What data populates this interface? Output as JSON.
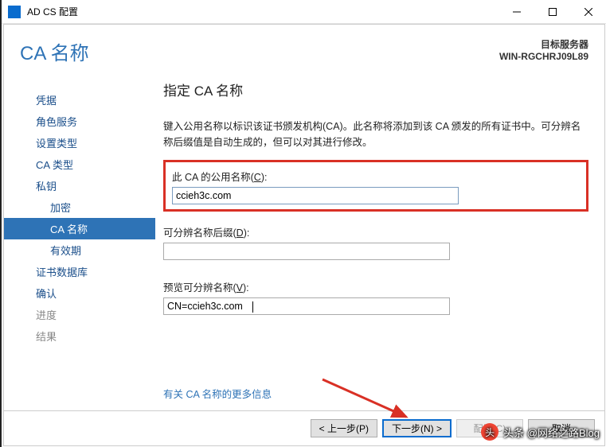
{
  "window": {
    "title": "AD CS 配置"
  },
  "header": {
    "page_title": "CA 名称",
    "server_label": "目标服务器",
    "server_name": "WIN-RGCHRJ09L89"
  },
  "nav": {
    "items": [
      {
        "label": "凭据",
        "key": "credentials"
      },
      {
        "label": "角色服务",
        "key": "role-services"
      },
      {
        "label": "设置类型",
        "key": "setup-type"
      },
      {
        "label": "CA 类型",
        "key": "ca-type"
      },
      {
        "label": "私钥",
        "key": "private-key"
      },
      {
        "label": "加密",
        "key": "crypto",
        "sub": true
      },
      {
        "label": "CA 名称",
        "key": "ca-name",
        "sub": true,
        "selected": true
      },
      {
        "label": "有效期",
        "key": "validity",
        "sub": true
      },
      {
        "label": "证书数据库",
        "key": "cert-db"
      },
      {
        "label": "确认",
        "key": "confirm"
      },
      {
        "label": "进度",
        "key": "progress",
        "disabled": true
      },
      {
        "label": "结果",
        "key": "results",
        "disabled": true
      }
    ]
  },
  "main": {
    "heading": "指定 CA 名称",
    "description": "键入公用名称以标识该证书颁发机构(CA)。此名称将添加到该 CA 颁发的所有证书中。可分辨名称后缀值是自动生成的，但可以对其进行修改。",
    "common_name": {
      "label_pre": "此 CA 的公用名称(",
      "accel": "C",
      "label_post": "):",
      "value": "ccieh3c.com"
    },
    "dn_suffix": {
      "label_pre": "可分辨名称后缀(",
      "accel": "D",
      "label_post": "):",
      "value": ""
    },
    "preview": {
      "label_pre": "预览可分辨名称(",
      "accel": "V",
      "label_post": "):",
      "value": "CN=ccieh3c.com"
    },
    "more_info_link": "有关 CA 名称的更多信息"
  },
  "footer": {
    "prev": "< 上一步(P)",
    "next": "下一步(N) >",
    "config": "配置(C)",
    "cancel": "取消"
  },
  "watermark": {
    "text": "头条 @网络之路Blog"
  }
}
